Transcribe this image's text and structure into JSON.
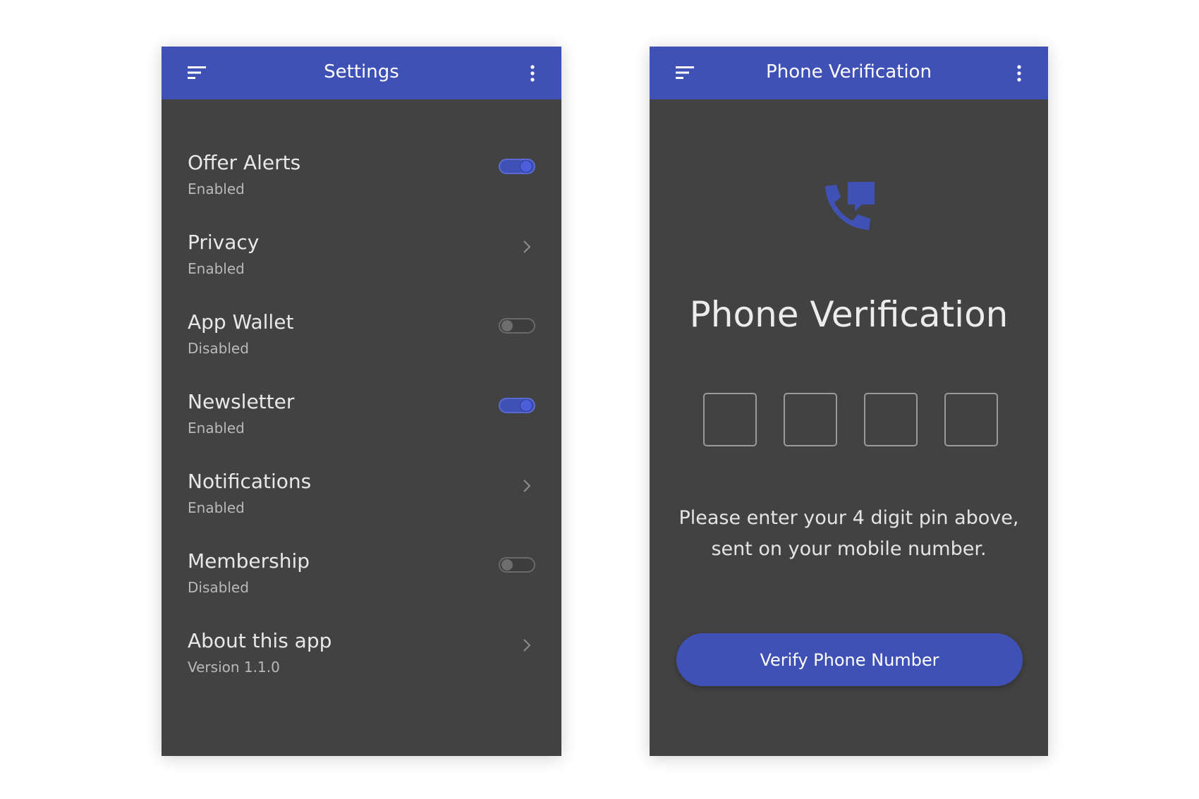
{
  "colors": {
    "primary": "#3f51b5",
    "surface": "#424242",
    "text_primary": "#e8e8e8",
    "text_secondary": "#b9b9b9"
  },
  "settings_screen": {
    "appbar": {
      "title": "Settings",
      "left_icon": "sort-menu-icon",
      "right_icon": "more-vertical-icon"
    },
    "items": [
      {
        "title": "Offer Alerts",
        "subtitle": "Enabled",
        "control": "toggle",
        "on": true
      },
      {
        "title": "Privacy",
        "subtitle": "Enabled",
        "control": "chevron"
      },
      {
        "title": "App Wallet",
        "subtitle": "Disabled",
        "control": "toggle",
        "on": false
      },
      {
        "title": "Newsletter",
        "subtitle": "Enabled",
        "control": "toggle",
        "on": true
      },
      {
        "title": "Notifications",
        "subtitle": "Enabled",
        "control": "chevron"
      },
      {
        "title": "Membership",
        "subtitle": "Disabled",
        "control": "toggle",
        "on": false
      },
      {
        "title": "About this app",
        "subtitle": "Version 1.1.0",
        "control": "chevron"
      }
    ]
  },
  "verification_screen": {
    "appbar": {
      "title": "Phone Verification",
      "left_icon": "sort-menu-icon",
      "right_icon": "more-vertical-icon"
    },
    "icon": "phone-message-icon",
    "heading": "Phone Verification",
    "pin_digits": [
      "",
      "",
      "",
      ""
    ],
    "message_line1": "Please enter your 4 digit pin above,",
    "message_line2": "sent on your mobile number.",
    "button_label": "Verify Phone Number"
  }
}
